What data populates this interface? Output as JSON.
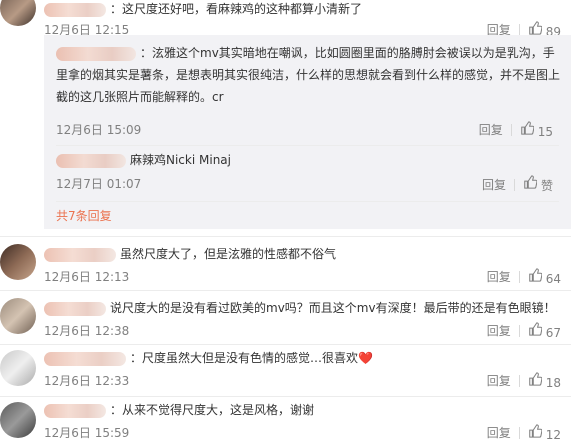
{
  "comments": [
    {
      "text": "：这尺度还好吧，看麻辣鸡的这种都算小清新了",
      "time": "12月6日 12:15",
      "reply_label": "回复",
      "likes": "89"
    },
    {
      "text": "虽然尺度大了，但是泫雅的性感都不俗气",
      "time": "12月6日 12:13",
      "reply_label": "回复",
      "likes": "64"
    },
    {
      "text": "说尺度大的是没有看过欧美的mv吗？而且这个mv有深度！最后带的还是有色眼镜！",
      "time": "12月6日 12:38",
      "reply_label": "回复",
      "likes": "67"
    },
    {
      "text": "：尺度虽然大但是没有色情的感觉…很喜欢",
      "emoji": "❤️",
      "time": "12月6日 12:33",
      "reply_label": "回复",
      "likes": "18"
    },
    {
      "text": "：从来不觉得尺度大，这是风格，谢谢",
      "time": "12月6日 15:59",
      "reply_label": "回复",
      "likes": "12"
    }
  ],
  "sub_replies": [
    {
      "text": "：泫雅这个mv其实暗地在嘲讽，比如圆圈里面的胳膊肘会被误以为是乳沟，手里拿的烟其实是薯条，是想表明其实很纯洁，什么样的思想就会看到什么样的感觉，并不是图上截的这几张照片而能解释的。cr",
      "time": "12月6日 15:09",
      "reply_label": "回复",
      "likes": "15"
    },
    {
      "text": "麻辣鸡Nicki Minaj",
      "time": "12月7日 01:07",
      "reply_label": "回复",
      "likes": "赞"
    }
  ],
  "more_replies_label": "共7条回复"
}
